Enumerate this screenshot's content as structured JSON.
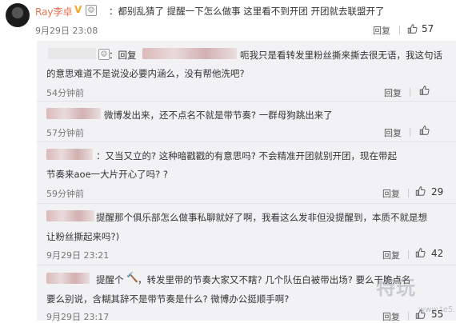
{
  "post": {
    "username": "Ray李卓",
    "badge": "V",
    "text": "：都别乱猜了 提醒一下怎么做事  这里看不到开团 开团就去联盟开了",
    "timestamp": "9月29日 23:08",
    "reply": "回复",
    "likes": "57"
  },
  "comments": [
    {
      "line1_prefix": "：回复",
      "line1_rest": "呃我只是看转发里粉丝撕来撕去很无语，我这句话",
      "line2": "的意思难道不是说没必要内涵么，没有帮他洗吧?",
      "time": "54分钟前",
      "reply": "回复",
      "likes": ""
    },
    {
      "line1": "微博发出来，还不点名不就是带节奏? 一群母狗跳出来了",
      "time": "57分钟前",
      "reply": "回复",
      "likes": ""
    },
    {
      "line1": "：又当又立的? 这种暗戳戳的有意思吗? 不会精准开团就别开团，现在带起",
      "line2": "节奏来aoe一大片开心了吗? ?",
      "time": "59分钟前",
      "reply": "回复",
      "likes": "29"
    },
    {
      "line1": "提醒那个俱乐部怎么做事私聊就好了啊，我看这么发非但没提醒到，本质不就是想",
      "line2": "让粉丝撕起来吗?)",
      "time": "9月29日 23:21",
      "reply": "回复",
      "likes": "42"
    },
    {
      "line1": "提醒个",
      "line1_rest": "，转发里带的节奏大家又不瞎? 几个队伍白被带出场? 要么干脆点名",
      "line2": "要么别说，含糊其辞不是带节奏是什么? 微博办公挺顺手啊?",
      "time": "9月29日 23:17",
      "reply": "回复",
      "likes": "55"
    }
  ],
  "watermark": {
    "main": "特玩",
    "sub": "www.te5.com"
  },
  "colors": {
    "link": "#eb7350",
    "panel": "#f2f2f5",
    "badge": "#f5a623"
  },
  "icons": [
    "avatar",
    "vip-badge-icon",
    "emoji-icon",
    "thumb-up-icon",
    "hammer-icon"
  ]
}
